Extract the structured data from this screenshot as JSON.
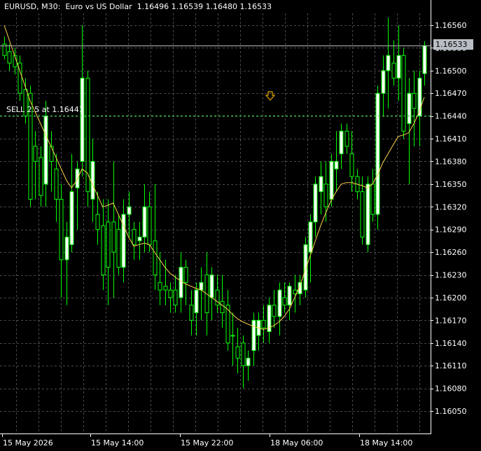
{
  "window": {
    "title": "EURUSD, M30:  Euro vs US Dollar  1.16496 1.16539 1.16480 1.16533",
    "symbol": "EURUSD",
    "timeframe": "M30",
    "description": "Euro vs US Dollar"
  },
  "bid_tag": "1.16533",
  "order": {
    "label": "SELL 2.5 at 1.16441",
    "price": 1.16441
  },
  "arrow_marker": {
    "icon": "down-arrow-icon",
    "color": "#e0a800"
  },
  "colors": {
    "background": "#000000",
    "grid": "#4a4a4a",
    "bull_candle": "#ffffff",
    "candle_outline": "#00ff00",
    "moving_average": "#ffd34d",
    "bid_line": "#b9bec4",
    "order_line": "#2ecc40",
    "axis_text": "#ffffff"
  },
  "chart_data": {
    "type": "candlestick",
    "title": "EURUSD, M30:  Euro vs US Dollar  1.16496 1.16539 1.16480 1.16533",
    "y_tick_labels": [
      "1.16560",
      "1.16530",
      "1.16500",
      "1.16470",
      "1.16440",
      "1.16410",
      "1.16380",
      "1.16350",
      "1.16320",
      "1.16290",
      "1.16260",
      "1.16230",
      "1.16200",
      "1.16170",
      "1.16140",
      "1.16110",
      "1.16080",
      "1.16050"
    ],
    "y_range": [
      1.16022,
      1.1658
    ],
    "x_tick_labels": [
      "15 May 2026",
      "15 May 14:00",
      "15 May 22:00",
      "18 May 06:00",
      "18 May 14:00"
    ],
    "grid": true,
    "candles": [
      {
        "o": 1.16535,
        "h": 1.16545,
        "l": 1.16515,
        "c": 1.1652
      },
      {
        "o": 1.16525,
        "h": 1.16535,
        "l": 1.165,
        "c": 1.1651
      },
      {
        "o": 1.1652,
        "h": 1.1653,
        "l": 1.16495,
        "c": 1.16505
      },
      {
        "o": 1.1651,
        "h": 1.1652,
        "l": 1.1646,
        "c": 1.1647
      },
      {
        "o": 1.16475,
        "h": 1.1649,
        "l": 1.1643,
        "c": 1.1644
      },
      {
        "o": 1.1647,
        "h": 1.1648,
        "l": 1.1632,
        "c": 1.1633
      },
      {
        "o": 1.164,
        "h": 1.1642,
        "l": 1.1633,
        "c": 1.1638
      },
      {
        "o": 1.16385,
        "h": 1.164,
        "l": 1.1632,
        "c": 1.16335
      },
      {
        "o": 1.1635,
        "h": 1.1646,
        "l": 1.1632,
        "c": 1.1644
      },
      {
        "o": 1.164,
        "h": 1.1642,
        "l": 1.1634,
        "c": 1.1638
      },
      {
        "o": 1.1637,
        "h": 1.1639,
        "l": 1.163,
        "c": 1.1633
      },
      {
        "o": 1.1633,
        "h": 1.1635,
        "l": 1.162,
        "c": 1.1625
      },
      {
        "o": 1.1625,
        "h": 1.163,
        "l": 1.1619,
        "c": 1.1628
      },
      {
        "o": 1.1627,
        "h": 1.1639,
        "l": 1.1626,
        "c": 1.1634
      },
      {
        "o": 1.16345,
        "h": 1.1638,
        "l": 1.1629,
        "c": 1.1637
      },
      {
        "o": 1.1638,
        "h": 1.1656,
        "l": 1.1636,
        "c": 1.1649
      },
      {
        "o": 1.1649,
        "h": 1.165,
        "l": 1.1632,
        "c": 1.1634
      },
      {
        "o": 1.1633,
        "h": 1.1641,
        "l": 1.163,
        "c": 1.1638
      },
      {
        "o": 1.1631,
        "h": 1.1634,
        "l": 1.1627,
        "c": 1.1629
      },
      {
        "o": 1.16295,
        "h": 1.1633,
        "l": 1.1621,
        "c": 1.1623
      },
      {
        "o": 1.163,
        "h": 1.1633,
        "l": 1.1619,
        "c": 1.1624
      },
      {
        "o": 1.163,
        "h": 1.1638,
        "l": 1.162,
        "c": 1.1626
      },
      {
        "o": 1.1629,
        "h": 1.1631,
        "l": 1.1623,
        "c": 1.1624
      },
      {
        "o": 1.1624,
        "h": 1.1633,
        "l": 1.1622,
        "c": 1.1631
      },
      {
        "o": 1.1631,
        "h": 1.1634,
        "l": 1.1628,
        "c": 1.1632
      },
      {
        "o": 1.1629,
        "h": 1.163,
        "l": 1.1625,
        "c": 1.1627
      },
      {
        "o": 1.16275,
        "h": 1.163,
        "l": 1.1625,
        "c": 1.1628
      },
      {
        "o": 1.1628,
        "h": 1.1635,
        "l": 1.1626,
        "c": 1.1632
      },
      {
        "o": 1.1632,
        "h": 1.1634,
        "l": 1.1626,
        "c": 1.1627
      },
      {
        "o": 1.16275,
        "h": 1.1635,
        "l": 1.1621,
        "c": 1.1623
      },
      {
        "o": 1.1622,
        "h": 1.1626,
        "l": 1.1619,
        "c": 1.1621
      },
      {
        "o": 1.16215,
        "h": 1.1625,
        "l": 1.1619,
        "c": 1.1621
      },
      {
        "o": 1.1621,
        "h": 1.1622,
        "l": 1.1618,
        "c": 1.162
      },
      {
        "o": 1.1621,
        "h": 1.1623,
        "l": 1.1618,
        "c": 1.1619
      },
      {
        "o": 1.162,
        "h": 1.1626,
        "l": 1.1618,
        "c": 1.1624
      },
      {
        "o": 1.1624,
        "h": 1.1625,
        "l": 1.1619,
        "c": 1.1622
      },
      {
        "o": 1.1619,
        "h": 1.1621,
        "l": 1.1615,
        "c": 1.1617
      },
      {
        "o": 1.1618,
        "h": 1.1622,
        "l": 1.1615,
        "c": 1.1621
      },
      {
        "o": 1.1621,
        "h": 1.1624,
        "l": 1.1617,
        "c": 1.1622
      },
      {
        "o": 1.1623,
        "h": 1.1626,
        "l": 1.1615,
        "c": 1.1618
      },
      {
        "o": 1.162,
        "h": 1.1624,
        "l": 1.1617,
        "c": 1.1623
      },
      {
        "o": 1.1621,
        "h": 1.1623,
        "l": 1.1618,
        "c": 1.1619
      },
      {
        "o": 1.16195,
        "h": 1.1623,
        "l": 1.1616,
        "c": 1.1618
      },
      {
        "o": 1.1619,
        "h": 1.1621,
        "l": 1.1613,
        "c": 1.1614
      },
      {
        "o": 1.1615,
        "h": 1.1618,
        "l": 1.1611,
        "c": 1.1615
      },
      {
        "o": 1.16135,
        "h": 1.1616,
        "l": 1.161,
        "c": 1.1612
      },
      {
        "o": 1.1614,
        "h": 1.1615,
        "l": 1.1608,
        "c": 1.1611
      },
      {
        "o": 1.1611,
        "h": 1.1613,
        "l": 1.1609,
        "c": 1.1612
      },
      {
        "o": 1.1613,
        "h": 1.1618,
        "l": 1.1611,
        "c": 1.1617
      },
      {
        "o": 1.1615,
        "h": 1.1618,
        "l": 1.1613,
        "c": 1.1617
      },
      {
        "o": 1.1617,
        "h": 1.1619,
        "l": 1.1614,
        "c": 1.1616
      },
      {
        "o": 1.16155,
        "h": 1.162,
        "l": 1.1614,
        "c": 1.1619
      },
      {
        "o": 1.1619,
        "h": 1.1621,
        "l": 1.1616,
        "c": 1.16175
      },
      {
        "o": 1.16175,
        "h": 1.1622,
        "l": 1.1615,
        "c": 1.1621
      },
      {
        "o": 1.162,
        "h": 1.1622,
        "l": 1.1618,
        "c": 1.1619
      },
      {
        "o": 1.1619,
        "h": 1.1622,
        "l": 1.1617,
        "c": 1.16215
      },
      {
        "o": 1.1621,
        "h": 1.1623,
        "l": 1.1618,
        "c": 1.16205
      },
      {
        "o": 1.16205,
        "h": 1.1623,
        "l": 1.1619,
        "c": 1.1622
      },
      {
        "o": 1.1621,
        "h": 1.1628,
        "l": 1.162,
        "c": 1.1627
      },
      {
        "o": 1.1626,
        "h": 1.1631,
        "l": 1.1622,
        "c": 1.163
      },
      {
        "o": 1.163,
        "h": 1.1636,
        "l": 1.1628,
        "c": 1.1635
      },
      {
        "o": 1.1634,
        "h": 1.1638,
        "l": 1.1631,
        "c": 1.1636
      },
      {
        "o": 1.1635,
        "h": 1.1638,
        "l": 1.163,
        "c": 1.1632
      },
      {
        "o": 1.1633,
        "h": 1.1639,
        "l": 1.1632,
        "c": 1.1638
      },
      {
        "o": 1.1637,
        "h": 1.1642,
        "l": 1.1634,
        "c": 1.1638
      },
      {
        "o": 1.1639,
        "h": 1.1643,
        "l": 1.1637,
        "c": 1.1642
      },
      {
        "o": 1.1642,
        "h": 1.1643,
        "l": 1.1639,
        "c": 1.164
      },
      {
        "o": 1.1639,
        "h": 1.1642,
        "l": 1.1634,
        "c": 1.1636
      },
      {
        "o": 1.1636,
        "h": 1.1637,
        "l": 1.1633,
        "c": 1.1634
      },
      {
        "o": 1.1634,
        "h": 1.1636,
        "l": 1.1627,
        "c": 1.1628
      },
      {
        "o": 1.1627,
        "h": 1.1636,
        "l": 1.1626,
        "c": 1.1635
      },
      {
        "o": 1.1635,
        "h": 1.1637,
        "l": 1.163,
        "c": 1.1631
      },
      {
        "o": 1.1631,
        "h": 1.1648,
        "l": 1.1629,
        "c": 1.1647
      },
      {
        "o": 1.1647,
        "h": 1.1652,
        "l": 1.1644,
        "c": 1.165
      },
      {
        "o": 1.165,
        "h": 1.1657,
        "l": 1.1645,
        "c": 1.1652
      },
      {
        "o": 1.1651,
        "h": 1.1654,
        "l": 1.1648,
        "c": 1.1649
      },
      {
        "o": 1.1649,
        "h": 1.1656,
        "l": 1.1646,
        "c": 1.1652
      },
      {
        "o": 1.1652,
        "h": 1.1653,
        "l": 1.1641,
        "c": 1.1642
      },
      {
        "o": 1.1643,
        "h": 1.1649,
        "l": 1.1635,
        "c": 1.1647
      },
      {
        "o": 1.1647,
        "h": 1.165,
        "l": 1.164,
        "c": 1.1645
      },
      {
        "o": 1.1644,
        "h": 1.165,
        "l": 1.164,
        "c": 1.1649
      },
      {
        "o": 1.16496,
        "h": 1.16539,
        "l": 1.1648,
        "c": 1.16533
      }
    ],
    "moving_average": [
      1.1656,
      1.1654,
      1.1652,
      1.165,
      1.1648,
      1.1646,
      1.16445,
      1.1643,
      1.16415,
      1.164,
      1.16385,
      1.1637,
      1.16355,
      1.16345,
      1.16355,
      1.1637,
      1.16365,
      1.1635,
      1.16335,
      1.1632,
      1.16322,
      1.16325,
      1.1631,
      1.16295,
      1.1628,
      1.16268,
      1.1627,
      1.16272,
      1.1627,
      1.1626,
      1.1625,
      1.1624,
      1.16232,
      1.16227,
      1.16222,
      1.16218,
      1.16215,
      1.16212,
      1.1621,
      1.16205,
      1.162,
      1.16195,
      1.1619,
      1.16185,
      1.16178,
      1.16172,
      1.16168,
      1.16165,
      1.16162,
      1.1616,
      1.16158,
      1.1616,
      1.16163,
      1.16168,
      1.16175,
      1.16185,
      1.162,
      1.16215,
      1.16235,
      1.16255,
      1.16275,
      1.16295,
      1.16312,
      1.16328,
      1.1634,
      1.1635,
      1.16352,
      1.16352,
      1.1635,
      1.16348,
      1.16345,
      1.1635,
      1.16362,
      1.16378,
      1.1639,
      1.16402,
      1.16413,
      1.16415,
      1.16418,
      1.1643,
      1.16445,
      1.16465
    ]
  }
}
